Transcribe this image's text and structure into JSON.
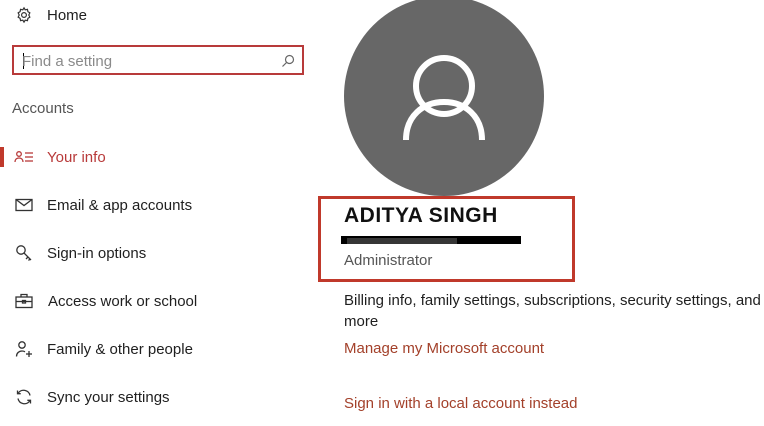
{
  "sidebar": {
    "home_label": "Home",
    "search_placeholder": "Find a setting",
    "section_heading": "Accounts",
    "items": [
      {
        "label": "Your info",
        "icon": "person-list-icon",
        "active": true
      },
      {
        "label": "Email & app accounts",
        "icon": "mail-icon"
      },
      {
        "label": "Sign-in options",
        "icon": "key-icon"
      },
      {
        "label": "Access work or school",
        "icon": "briefcase-icon"
      },
      {
        "label": "Family & other people",
        "icon": "person-add-icon"
      },
      {
        "label": "Sync your settings",
        "icon": "sync-icon"
      }
    ]
  },
  "profile": {
    "name": "ADITYA SINGH",
    "role": "Administrator"
  },
  "main": {
    "billing_text": "Billing info, family settings, subscriptions, security settings, and more",
    "manage_link": "Manage my Microsoft account",
    "local_link": "Sign in with a local account instead"
  },
  "colors": {
    "accent": "#c0392b",
    "link": "#a3402a",
    "avatar_bg": "#676767"
  }
}
